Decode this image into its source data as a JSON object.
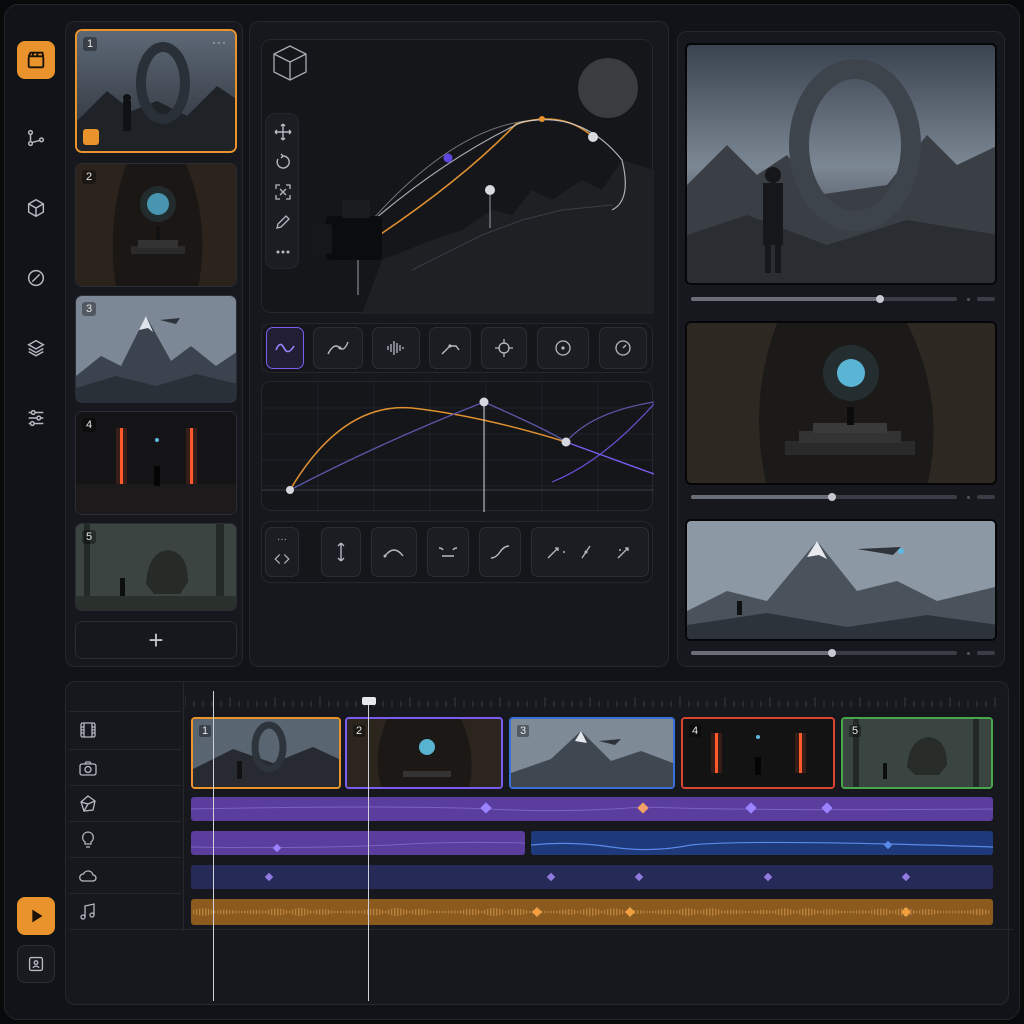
{
  "colors": {
    "accent": "#e8932b",
    "purple": "#7c5cf0",
    "blue": "#3a6fd8",
    "red": "#d9452e",
    "green": "#46a84a",
    "bg": "#111318"
  },
  "toolbar": {
    "items": [
      {
        "name": "clapperboard-icon",
        "active": true
      },
      {
        "name": "path-nodes-icon",
        "active": false
      },
      {
        "name": "cube-icon",
        "active": false
      },
      {
        "name": "slash-circle-icon",
        "active": false
      },
      {
        "name": "layers-icon",
        "active": false
      },
      {
        "name": "sliders-icon",
        "active": false
      }
    ],
    "bottom": [
      {
        "name": "play-icon"
      },
      {
        "name": "user-card-icon"
      }
    ]
  },
  "shots": [
    {
      "num": "1",
      "scene": "portal",
      "selected": true,
      "menu": "···"
    },
    {
      "num": "2",
      "scene": "cave",
      "selected": false
    },
    {
      "num": "3",
      "scene": "mountains",
      "selected": false
    },
    {
      "num": "4",
      "scene": "corridor",
      "selected": false
    },
    {
      "num": "5",
      "scene": "forest",
      "selected": false
    }
  ],
  "add_shot_label": "+",
  "viewport_tools": [
    "move-icon",
    "rotate-icon",
    "focus-icon",
    "pencil-icon",
    "more-icon"
  ],
  "curve_types": [
    "wave-curve-icon",
    "spline-curve-icon",
    "audio-wave-icon",
    "linear-path-icon",
    "target-icon",
    "circle-dot-icon",
    "dial-icon"
  ],
  "easing_tools": [
    "code-icon",
    "vertical-arrows-icon",
    "arc-icon",
    "ease-flat-icon",
    "ease-s-curve-icon",
    "handle-edit-icons"
  ],
  "easing_more": "···",
  "previews": [
    {
      "scene": "portal",
      "progress": 0.71
    },
    {
      "scene": "cave",
      "progress": 0.53
    },
    {
      "scene": "mountains",
      "progress": 0.53
    }
  ],
  "timeline": {
    "tracks": [
      "film-strip-icon",
      "camera-icon",
      "polygon-icon",
      "lightbulb-icon",
      "cloud-icon",
      "music-note-icon"
    ],
    "clips": [
      {
        "num": "1",
        "scene": "portal",
        "color": "#e8932b"
      },
      {
        "num": "2",
        "scene": "cave",
        "color": "#7c5cf0"
      },
      {
        "num": "3",
        "scene": "mountains",
        "color": "#3a6fd8"
      },
      {
        "num": "4",
        "scene": "corridor",
        "color": "#d9452e"
      },
      {
        "num": "5",
        "scene": "forest",
        "color": "#46a84a"
      }
    ]
  }
}
